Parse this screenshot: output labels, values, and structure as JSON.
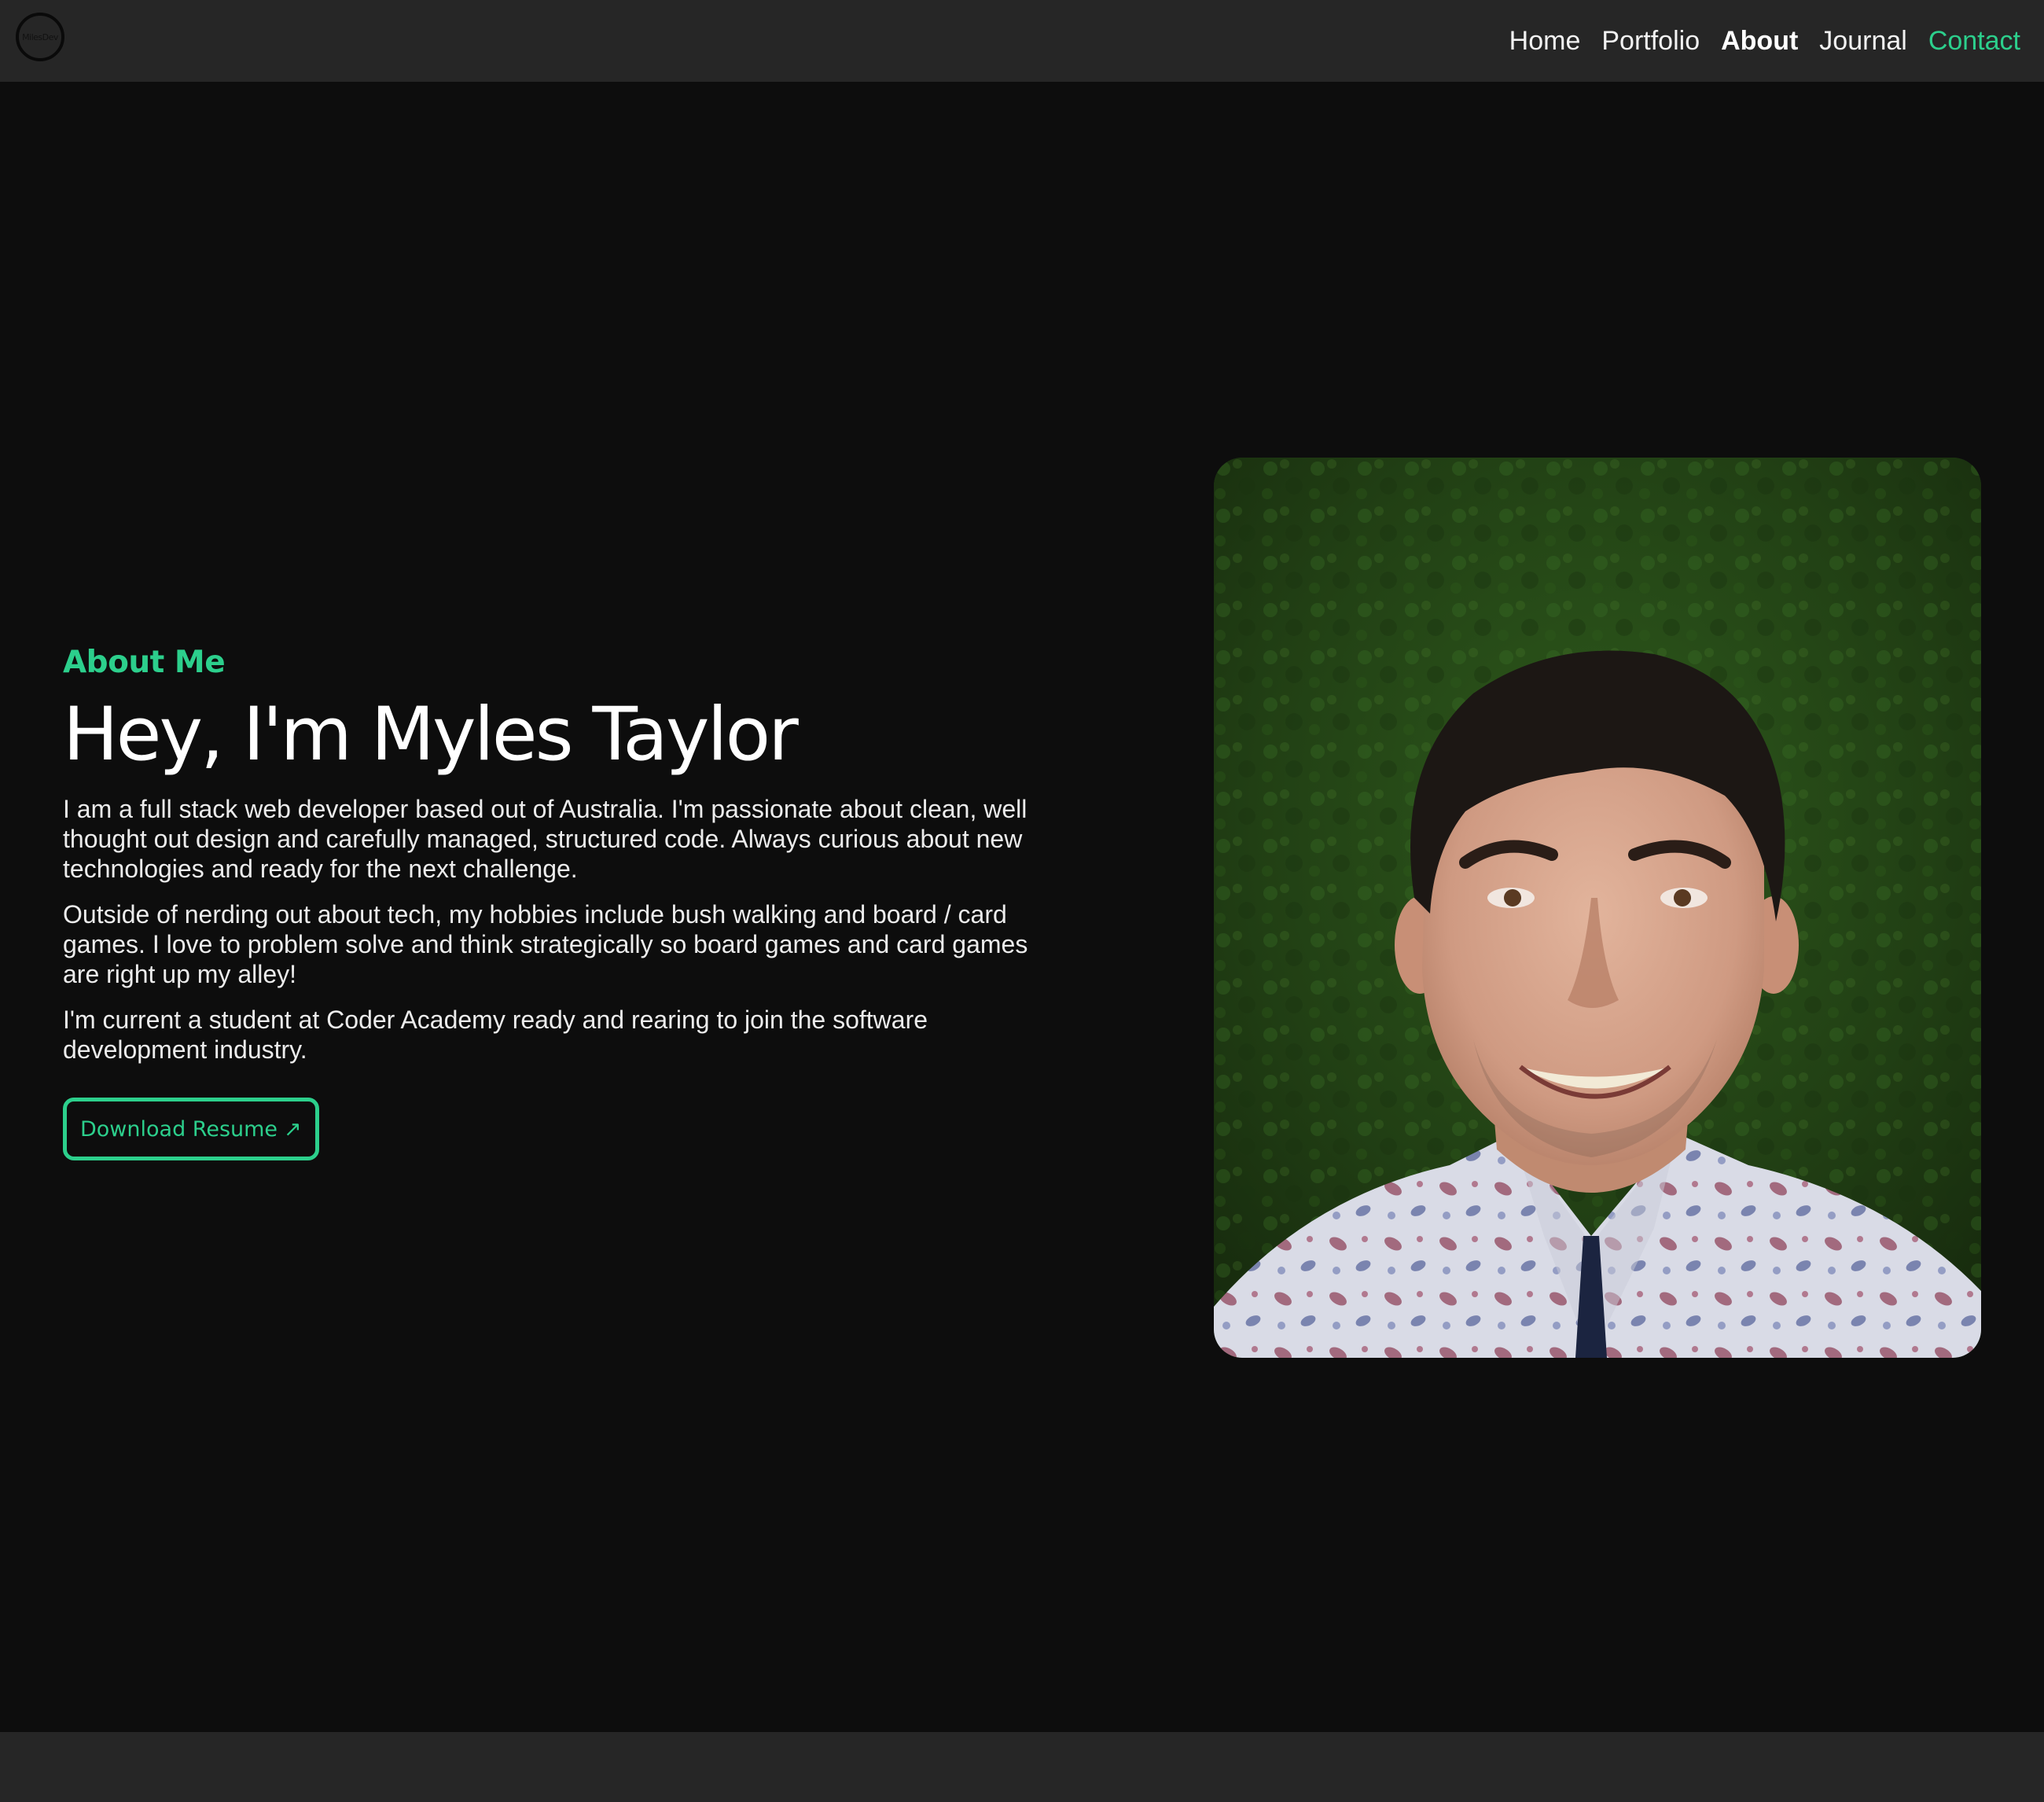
{
  "nav": {
    "logo_text": "MilesDev",
    "links": [
      {
        "label": "Home"
      },
      {
        "label": "Portfolio"
      },
      {
        "label": "About"
      },
      {
        "label": "Journal"
      },
      {
        "label": "Contact"
      }
    ],
    "active": "About"
  },
  "about": {
    "eyebrow": "About Me",
    "headline": "Hey, I'm Myles Taylor",
    "paragraphs": [
      "I am a full stack web developer based out of Australia. I'm passionate about clean, well thought out design and carefully managed, structured code. Always curious about new technologies and ready for the next challenge.",
      "Outside of nerding out about tech, my hobbies include bush walking and board / card games. I love to problem solve and think strategically so board games and card games are right up my alley!",
      "I'm current a student at Coder Academy ready and rearing to join the software development industry."
    ],
    "resume_button": "Download Resume",
    "resume_icon": "↗"
  },
  "colors": {
    "accent": "#2ccf8c",
    "background": "#0d0d0d",
    "navbar": "#262626"
  },
  "icons": {
    "logo": "circular-signature-logo",
    "resume": "external-arrow-icon"
  }
}
